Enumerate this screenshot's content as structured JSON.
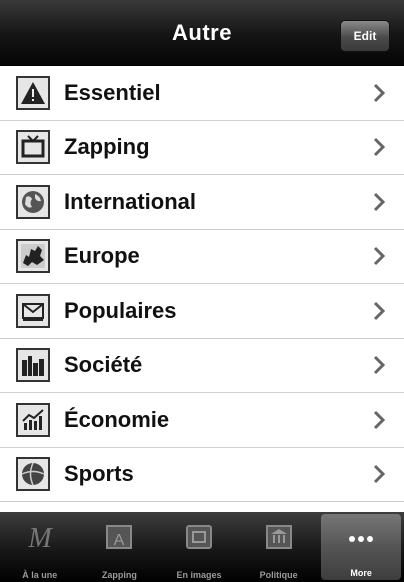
{
  "navbar": {
    "title": "Autre",
    "edit_label": "Edit"
  },
  "list": {
    "items": [
      {
        "label": "Essentiel",
        "icon": "warning-icon"
      },
      {
        "label": "Zapping",
        "icon": "tv-icon"
      },
      {
        "label": "International",
        "icon": "globe-icon"
      },
      {
        "label": "Europe",
        "icon": "europe-map-icon"
      },
      {
        "label": "Populaires",
        "icon": "envelope-icon"
      },
      {
        "label": "Société",
        "icon": "city-icon"
      },
      {
        "label": "Économie",
        "icon": "chart-icon"
      },
      {
        "label": "Sports",
        "icon": "ball-icon"
      }
    ]
  },
  "tabbar": {
    "tabs": [
      {
        "label": "À la une",
        "icon": "m-logo-icon",
        "selected": false
      },
      {
        "label": "Zapping",
        "icon": "zapping-icon",
        "selected": false
      },
      {
        "label": "En images",
        "icon": "images-icon",
        "selected": false
      },
      {
        "label": "Politique",
        "icon": "politique-icon",
        "selected": false
      },
      {
        "label": "More",
        "icon": "more-icon",
        "selected": true
      }
    ]
  }
}
